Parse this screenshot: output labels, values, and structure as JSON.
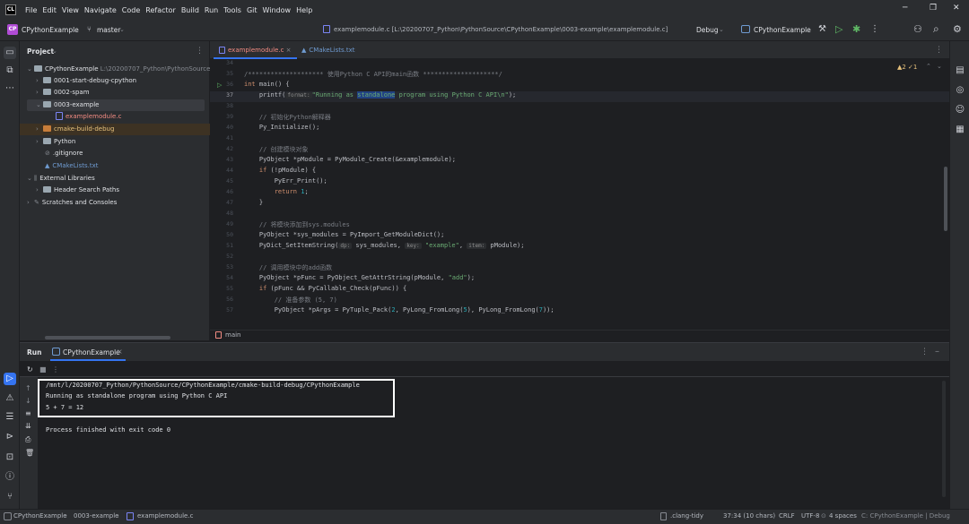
{
  "menu": [
    "File",
    "Edit",
    "View",
    "Navigate",
    "Code",
    "Refactor",
    "Build",
    "Run",
    "Tools",
    "Git",
    "Window",
    "Help"
  ],
  "toolbar": {
    "project_badge": "CP",
    "project_name": "CPythonExample",
    "branch": "master",
    "file_path": "examplemodule.c [L:\\20200707_Python\\PythonSource\\CPythonExample\\0003-example\\examplemodule.c]",
    "config": "Debug",
    "target": "CPythonExample"
  },
  "project_panel": {
    "title": "Project",
    "root": "CPythonExample",
    "root_path": "L:\\20200707_Python\\PythonSource\\CP",
    "items": [
      "0001-start-debug-cpython",
      "0002-spam",
      "0003-example",
      "examplemodule.c",
      "cmake-build-debug",
      "Python",
      ".gitignore",
      "CMakeLists.txt",
      "External Libraries",
      "Header Search Paths",
      "Scratches and Consoles"
    ]
  },
  "editor": {
    "tabs": [
      "examplemodule.c",
      "CMakeLists.txt"
    ],
    "warnings": "▲2 ✓1",
    "breadcrumb": "main",
    "line_numbers": [
      "34",
      "35",
      "36",
      "37",
      "38",
      "39",
      "40",
      "41",
      "42",
      "43",
      "44",
      "45",
      "46",
      "47",
      "48",
      "49",
      "50",
      "51",
      "52",
      "53",
      "54",
      "55",
      "56",
      "57"
    ],
    "lines": {
      "l35": "/******************** 使用Python C API的main函数 ********************/",
      "l36a": "int",
      "l36b": " main() {",
      "l37a": "    printf(",
      "l37hint": "format:",
      "l37b": "\"Running as ",
      "l37sel": "standalone",
      "l37c": " program using Python C API\\n\"",
      "l37d": ");",
      "l39": "    // 初始化Python解释器",
      "l40": "    Py_Initialize();",
      "l42": "    // 创建模块对象",
      "l43": "    PyObject *pModule = PyModule_Create(&examplemodule);",
      "l44a": "    if",
      "l44b": " (!pModule) {",
      "l45": "        PyErr_Print();",
      "l46a": "        return",
      "l46b": " 1",
      "l46c": ";",
      "l47": "    }",
      "l49": "    // 将模块添加到sys.modules",
      "l50": "    PyObject *sys_modules = PyImport_GetModuleDict();",
      "l51a": "    PyDict_SetItemString(",
      "l51h1": "dp:",
      "l51b": " sys_modules, ",
      "l51h2": "key:",
      "l51c": " \"example\"",
      "l51d": ", ",
      "l51h3": "item:",
      "l51e": " pModule);",
      "l53": "    // 调用模块中的add函数",
      "l54a": "    PyObject *pFunc = PyObject_GetAttrString(pModule, ",
      "l54b": "\"add\"",
      "l54c": ");",
      "l55a": "    if",
      "l55b": " (pFunc && PyCallable_Check(pFunc)) {",
      "l56": "        // 准备参数 (5, 7)",
      "l57a": "        PyObject *pArgs = PyTuple_Pack(",
      "l57b": "2",
      "l57c": ", PyLong_FromLong(",
      "l57d": "5",
      "l57e": "), PyLong_FromLong(",
      "l57f": "7",
      "l57g": "));"
    }
  },
  "run_panel": {
    "title": "Run",
    "tab": "CPythonExample",
    "output": [
      "/mnt/l/20200707_Python/PythonSource/CPythonExample/cmake-build-debug/CPythonExample",
      "Running as standalone program using Python C API",
      "5 + 7 = 12"
    ],
    "exit": "Process finished with exit code 0"
  },
  "status_bar": {
    "crumbs": [
      "CPythonExample",
      "0003-example",
      "examplemodule.c"
    ],
    "clang_tidy": ".clang-tidy",
    "position": "37:34 (10 chars)",
    "line_sep": "CRLF",
    "encoding": "UTF-8",
    "indent": "4 spaces",
    "context": "C: CPythonExample | Debug"
  }
}
